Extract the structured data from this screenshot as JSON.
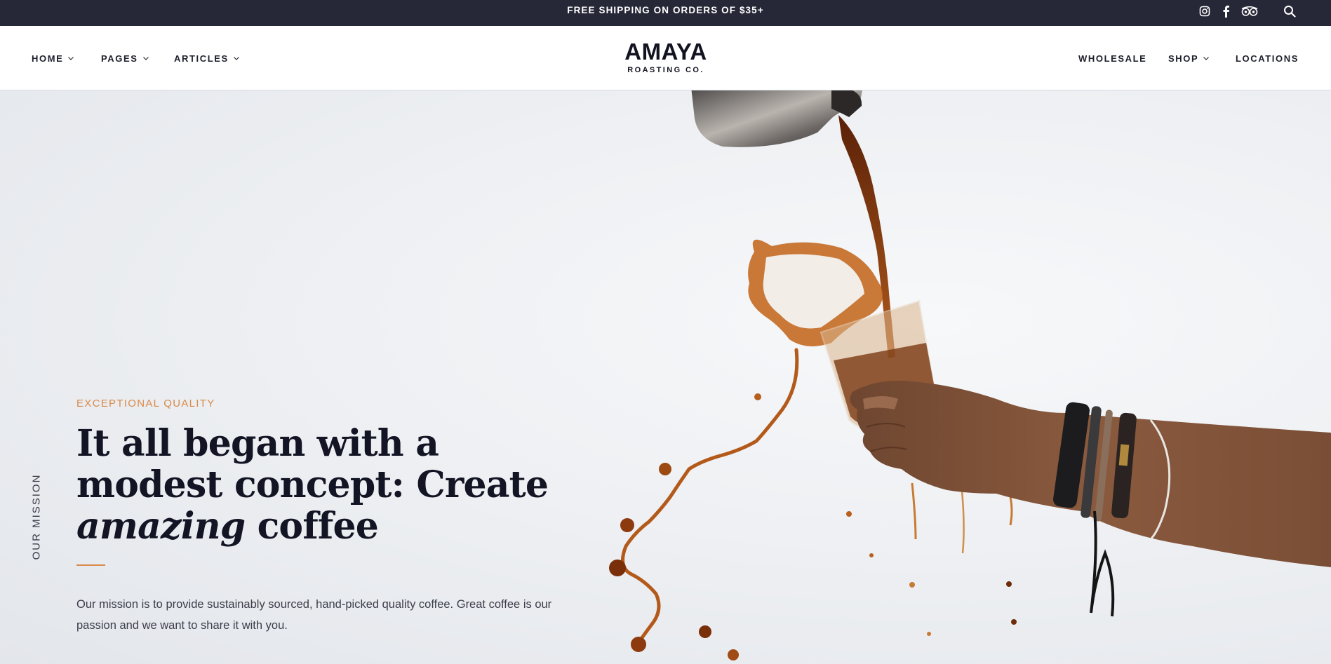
{
  "announcement": "FREE SHIPPING ON ORDERS OF $35+",
  "social": [
    "instagram-icon",
    "facebook-icon",
    "tripadvisor-icon",
    "search-icon"
  ],
  "nav_left": [
    {
      "label": "HOME",
      "dropdown": true
    },
    {
      "label": "PAGES",
      "dropdown": true
    },
    {
      "label": "ARTICLES",
      "dropdown": true
    }
  ],
  "nav_right": [
    {
      "label": "WHOLESALE",
      "dropdown": false
    },
    {
      "label": "SHOP",
      "dropdown": true
    },
    {
      "label": "LOCATIONS",
      "dropdown": false
    }
  ],
  "logo": {
    "wordmark": "AMAYA",
    "sub": "ROASTING CO."
  },
  "hero": {
    "side_label": "OUR MISSION",
    "eyebrow": "EXCEPTIONAL QUALITY",
    "headline_before": "It all began with a modest concept: Create ",
    "headline_italic": "amazing",
    "headline_after": " coffee",
    "body": "Our mission is to provide sustainably sourced, hand-picked quality coffee. Great coffee is our passion and we want to share it with you."
  },
  "colors": {
    "topbar": "#262737",
    "accent": "#d98a4a",
    "text": "#131424"
  }
}
